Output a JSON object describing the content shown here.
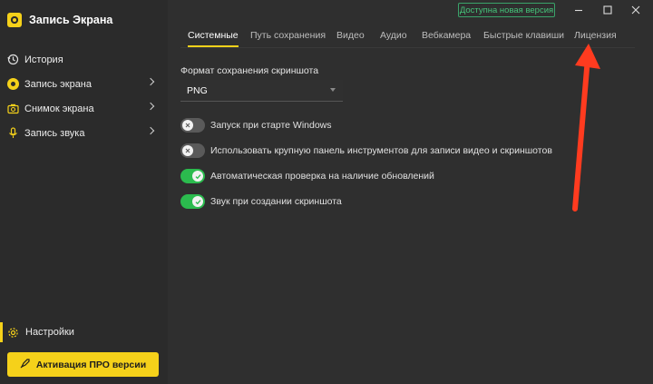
{
  "app": {
    "title": "Запись Экрана"
  },
  "sidebar": {
    "items": [
      {
        "label": "История",
        "icon": "history-icon"
      },
      {
        "label": "Запись экрана",
        "icon": "record-icon"
      },
      {
        "label": "Снимок экрана",
        "icon": "camera-icon"
      },
      {
        "label": "Запись звука",
        "icon": "microphone-icon"
      }
    ],
    "settings_label": "Настройки",
    "pro_button_label": "Активация ПРО версии"
  },
  "titlebar": {
    "update_badge": "Доступна новая версия"
  },
  "tabs": [
    {
      "label": "Системные",
      "active": true
    },
    {
      "label": "Путь сохранения",
      "active": false
    },
    {
      "label": "Видео",
      "active": false
    },
    {
      "label": "Аудио",
      "active": false
    },
    {
      "label": "Вебкамера",
      "active": false
    },
    {
      "label": "Быстрые клавиши",
      "active": false
    },
    {
      "label": "Лицензия",
      "active": false
    }
  ],
  "content": {
    "format_label": "Формат сохранения скриншота",
    "format_value": "PNG",
    "toggles": [
      {
        "label": "Запуск при старте Windows",
        "on": false
      },
      {
        "label": "Использовать крупную панель инструментов для записи видео и скриншотов",
        "on": false
      },
      {
        "label": "Автоматическая проверка на наличие обновлений",
        "on": true
      },
      {
        "label": "Звук при создании скриншота",
        "on": true
      }
    ]
  },
  "colors": {
    "accent": "#f5d11a",
    "toggle_on": "#2bbb4e",
    "annotation_arrow": "#ff3b1f"
  }
}
